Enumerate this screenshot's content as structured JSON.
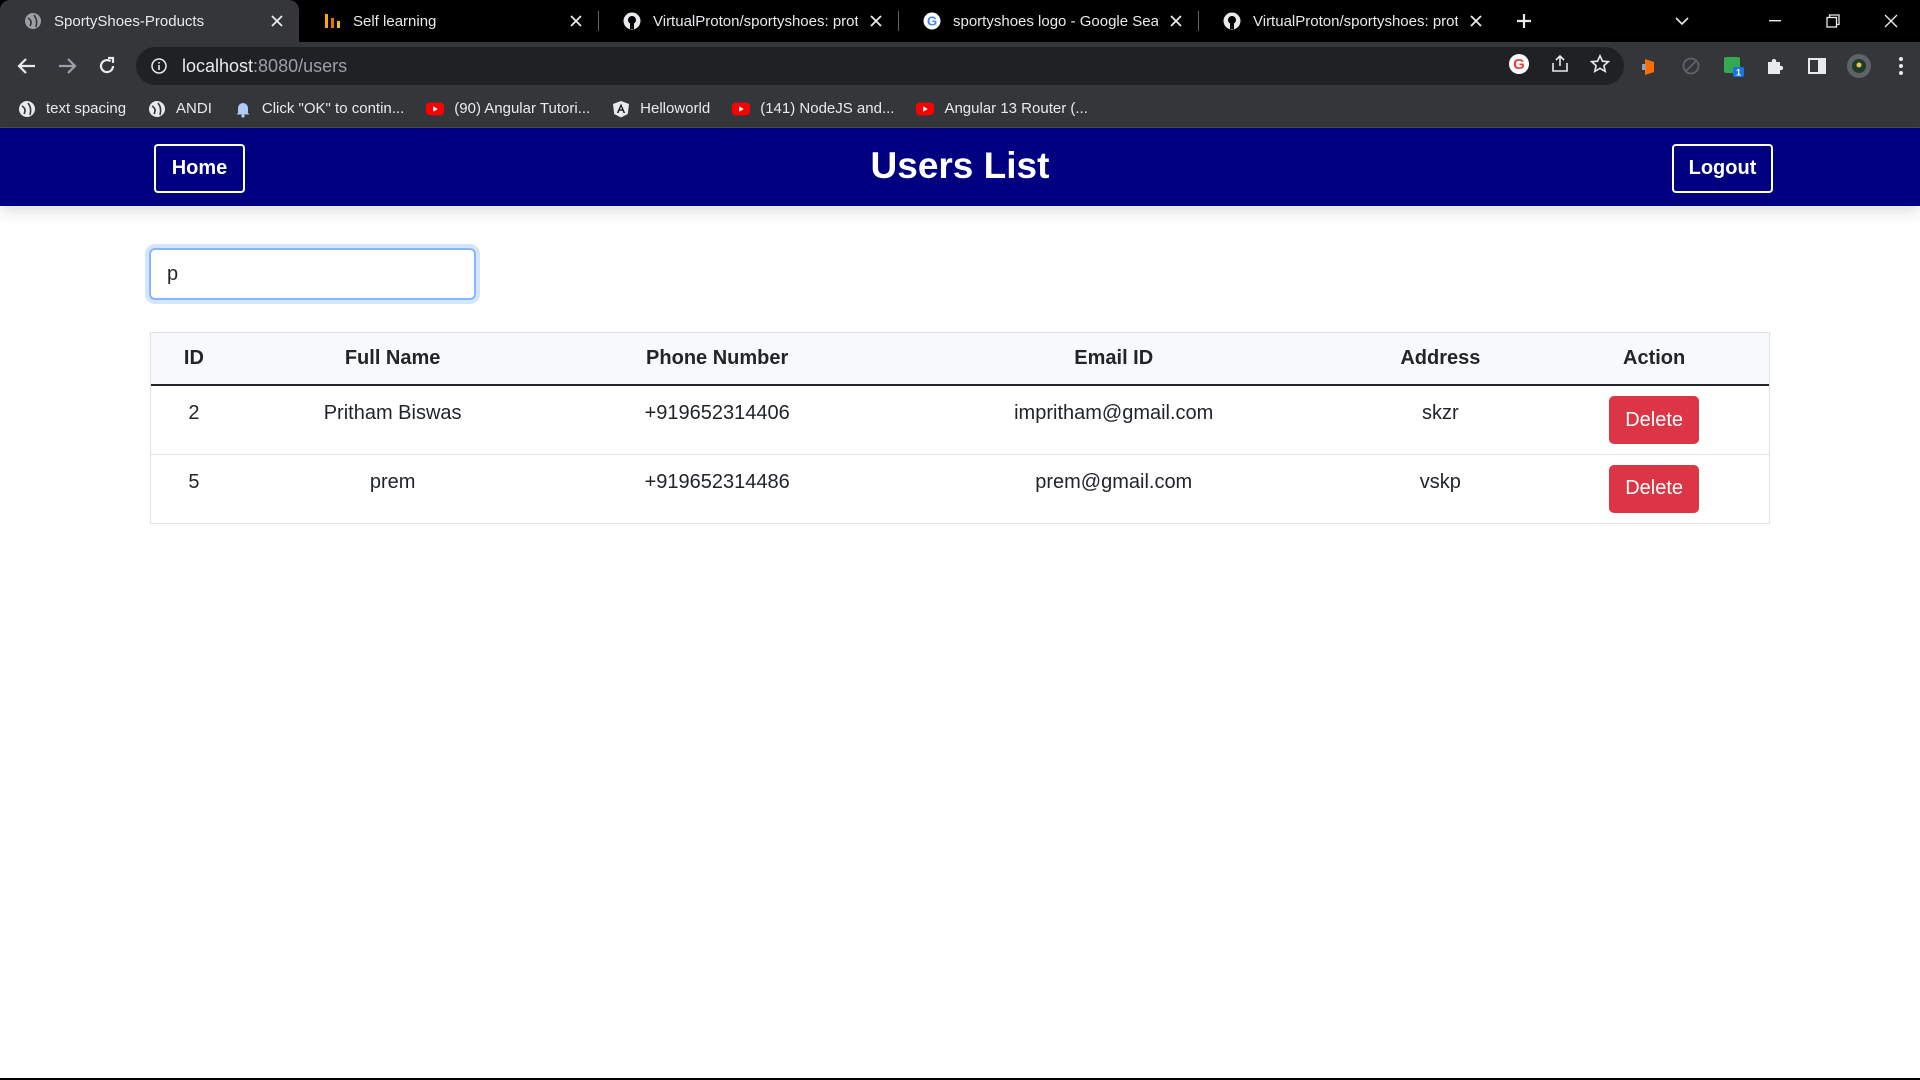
{
  "browser": {
    "tabs": [
      {
        "title": "SportyShoes-Products",
        "icon": "globe-icon",
        "active": true
      },
      {
        "title": "Self learning",
        "icon": "chart-bars-icon",
        "active": false
      },
      {
        "title": "VirtualProton/sportyshoes: proto",
        "icon": "github-icon",
        "active": false
      },
      {
        "title": "sportyshoes logo - Google Searc",
        "icon": "google-icon",
        "active": false
      },
      {
        "title": "VirtualProton/sportyshoes: proto",
        "icon": "github-icon",
        "active": false
      }
    ],
    "address": {
      "host": "localhost",
      "path": ":8080/users"
    },
    "bookmarks": [
      {
        "label": "text spacing",
        "icon": "globe-icon"
      },
      {
        "label": "ANDI",
        "icon": "globe-icon"
      },
      {
        "label": "Click \"OK\" to contin...",
        "icon": "bell-icon"
      },
      {
        "label": "(90) Angular Tutori...",
        "icon": "youtube-icon"
      },
      {
        "label": "Helloworld",
        "icon": "angular-icon"
      },
      {
        "label": "(141) NodeJS and...",
        "icon": "youtube-icon"
      },
      {
        "label": "Angular 13 Router (...",
        "icon": "youtube-icon"
      }
    ]
  },
  "header": {
    "title": "Users List",
    "home_label": "Home",
    "logout_label": "Logout",
    "background": "#000080"
  },
  "search": {
    "value": "p"
  },
  "table": {
    "columns": [
      "ID",
      "Full Name",
      "Phone Number",
      "Email ID",
      "Address",
      "Action"
    ],
    "rows": [
      {
        "id": "2",
        "name": "Pritham Biswas",
        "phone": "+919652314406",
        "email": "impritham@gmail.com",
        "address": "skzr",
        "action": "Delete"
      },
      {
        "id": "5",
        "name": "prem",
        "phone": "+919652314486",
        "email": "prem@gmail.com",
        "address": "vskp",
        "action": "Delete"
      }
    ]
  },
  "colors": {
    "delete": "#dc3545",
    "focus": "#86b7fe"
  }
}
